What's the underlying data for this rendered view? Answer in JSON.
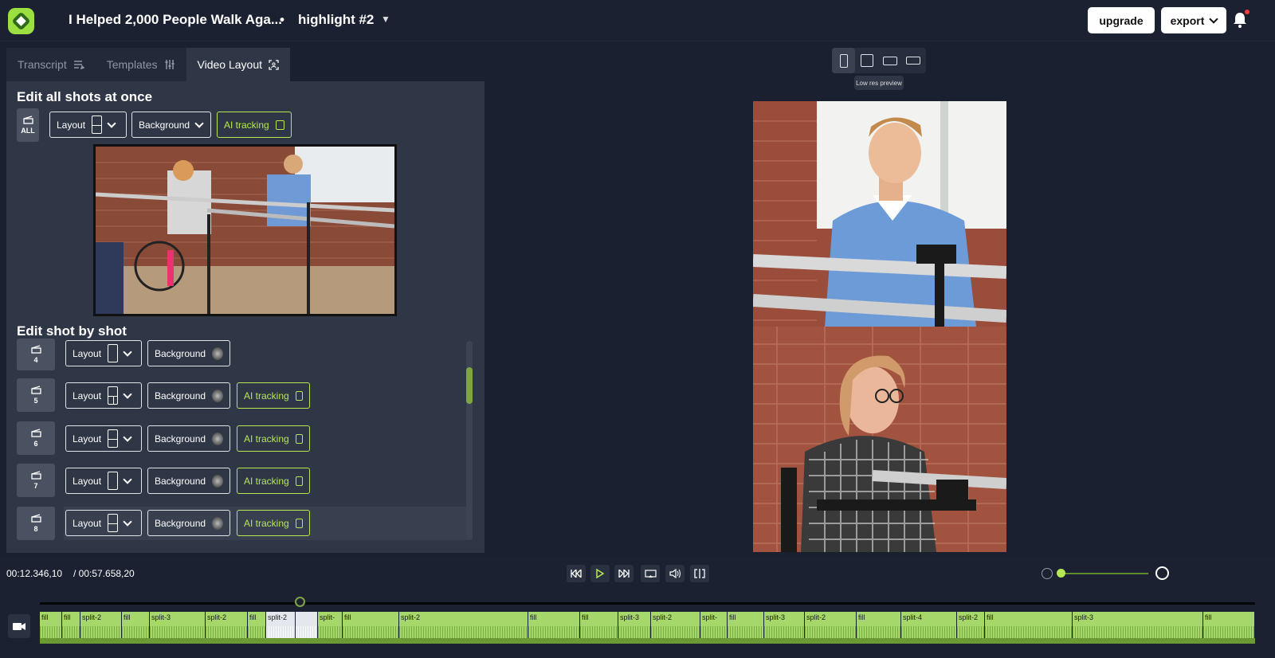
{
  "header": {
    "project_title": "I Helped 2,000 People Walk Aga...",
    "separator": "•",
    "highlight": "highlight #2",
    "upgrade_label": "upgrade",
    "export_label": "export"
  },
  "tabs": [
    {
      "label": "Transcript",
      "icon": "transcript-icon",
      "active": false
    },
    {
      "label": "Templates",
      "icon": "sliders-icon",
      "active": false
    },
    {
      "label": "Video Layout",
      "icon": "focus-icon",
      "active": true
    }
  ],
  "edit_all": {
    "title": "Edit all shots at once",
    "all_label": "ALL",
    "layout_label": "Layout",
    "background_label": "Background",
    "ai_label": "AI tracking"
  },
  "shot_section": {
    "title": "Edit shot by shot",
    "shots": [
      {
        "num": "4",
        "layout": "single",
        "bg": "Background",
        "ai": false
      },
      {
        "num": "5",
        "layout": "split-4",
        "bg": "Background",
        "ai": true
      },
      {
        "num": "6",
        "layout": "split-h",
        "bg": "Background",
        "ai": true
      },
      {
        "num": "7",
        "layout": "single",
        "bg": "Background",
        "ai": true
      },
      {
        "num": "8",
        "layout": "split-h",
        "bg": "Background",
        "ai": true
      }
    ],
    "layout_label": "Layout",
    "ai_label": "AI tracking"
  },
  "viewer": {
    "tooltip": "Low res preview",
    "ratios": [
      "9:16",
      "1:1",
      "16:9",
      "wide"
    ]
  },
  "playback": {
    "current": "00:12.346,10",
    "total": "/ 00:57.658,20"
  },
  "colors": {
    "accent": "#b5e852",
    "bg": "#1a2030",
    "panel": "#2f3646"
  },
  "timeline": {
    "clips": [
      {
        "label": "fill"
      },
      {
        "label": "fill"
      },
      {
        "label": "split-2"
      },
      {
        "label": "fill"
      },
      {
        "label": "split-3"
      },
      {
        "label": "split-2"
      },
      {
        "label": "fill"
      },
      {
        "label": "split-2"
      },
      {
        "label": ""
      },
      {
        "label": "split-"
      },
      {
        "label": "fill"
      },
      {
        "label": "split-2"
      },
      {
        "label": "fill"
      },
      {
        "label": "fill"
      },
      {
        "label": "split-3"
      },
      {
        "label": "split-2"
      },
      {
        "label": "split-"
      },
      {
        "label": "fill"
      },
      {
        "label": "split-3"
      },
      {
        "label": "split-2"
      },
      {
        "label": "fill"
      },
      {
        "label": "split-4"
      },
      {
        "label": "split-2"
      },
      {
        "label": "fill"
      },
      {
        "label": "split-3"
      },
      {
        "label": "fill"
      }
    ]
  }
}
